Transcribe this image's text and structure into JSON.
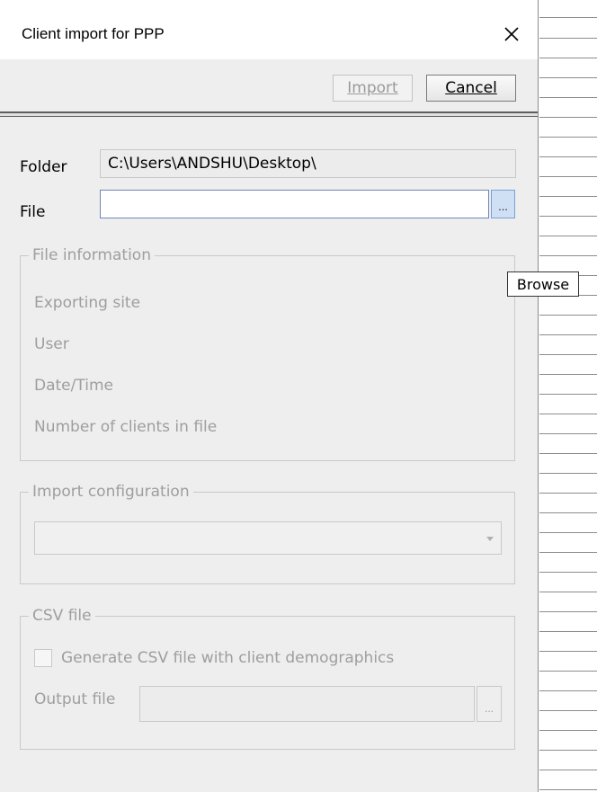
{
  "window": {
    "title": "Client import for PPP",
    "close_icon": "close-icon"
  },
  "toolbar": {
    "import_label": "Import",
    "cancel_label": "Cancel"
  },
  "form": {
    "folder_label": "Folder",
    "folder_value": "C:\\Users\\ANDSHU\\Desktop\\",
    "file_label": "File",
    "file_value": "",
    "browse_label": "...",
    "tooltip": "Browse"
  },
  "file_information": {
    "legend": "File information",
    "fields": [
      "Exporting site",
      "User",
      "Date/Time",
      "Number of clients in file"
    ]
  },
  "import_configuration": {
    "legend": "Import configuration",
    "selected": ""
  },
  "csv_file": {
    "legend": "CSV file",
    "checkbox_label": "Generate CSV file with client demographics",
    "checked": false,
    "output_label": "Output file",
    "output_value": "",
    "browse_label": "..."
  }
}
